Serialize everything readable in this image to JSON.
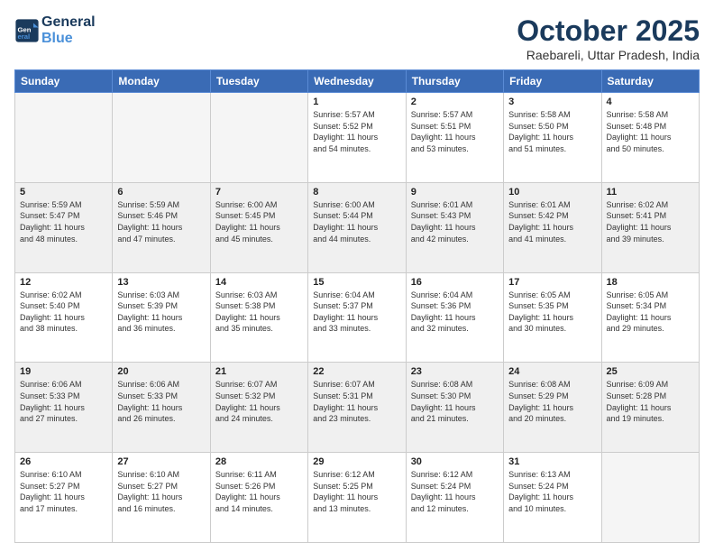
{
  "logo": {
    "line1": "General",
    "line2": "Blue"
  },
  "header": {
    "month": "October 2025",
    "location": "Raebareli, Uttar Pradesh, India"
  },
  "weekdays": [
    "Sunday",
    "Monday",
    "Tuesday",
    "Wednesday",
    "Thursday",
    "Friday",
    "Saturday"
  ],
  "weeks": [
    [
      {
        "day": "",
        "info": ""
      },
      {
        "day": "",
        "info": ""
      },
      {
        "day": "",
        "info": ""
      },
      {
        "day": "1",
        "info": "Sunrise: 5:57 AM\nSunset: 5:52 PM\nDaylight: 11 hours\nand 54 minutes."
      },
      {
        "day": "2",
        "info": "Sunrise: 5:57 AM\nSunset: 5:51 PM\nDaylight: 11 hours\nand 53 minutes."
      },
      {
        "day": "3",
        "info": "Sunrise: 5:58 AM\nSunset: 5:50 PM\nDaylight: 11 hours\nand 51 minutes."
      },
      {
        "day": "4",
        "info": "Sunrise: 5:58 AM\nSunset: 5:48 PM\nDaylight: 11 hours\nand 50 minutes."
      }
    ],
    [
      {
        "day": "5",
        "info": "Sunrise: 5:59 AM\nSunset: 5:47 PM\nDaylight: 11 hours\nand 48 minutes."
      },
      {
        "day": "6",
        "info": "Sunrise: 5:59 AM\nSunset: 5:46 PM\nDaylight: 11 hours\nand 47 minutes."
      },
      {
        "day": "7",
        "info": "Sunrise: 6:00 AM\nSunset: 5:45 PM\nDaylight: 11 hours\nand 45 minutes."
      },
      {
        "day": "8",
        "info": "Sunrise: 6:00 AM\nSunset: 5:44 PM\nDaylight: 11 hours\nand 44 minutes."
      },
      {
        "day": "9",
        "info": "Sunrise: 6:01 AM\nSunset: 5:43 PM\nDaylight: 11 hours\nand 42 minutes."
      },
      {
        "day": "10",
        "info": "Sunrise: 6:01 AM\nSunset: 5:42 PM\nDaylight: 11 hours\nand 41 minutes."
      },
      {
        "day": "11",
        "info": "Sunrise: 6:02 AM\nSunset: 5:41 PM\nDaylight: 11 hours\nand 39 minutes."
      }
    ],
    [
      {
        "day": "12",
        "info": "Sunrise: 6:02 AM\nSunset: 5:40 PM\nDaylight: 11 hours\nand 38 minutes."
      },
      {
        "day": "13",
        "info": "Sunrise: 6:03 AM\nSunset: 5:39 PM\nDaylight: 11 hours\nand 36 minutes."
      },
      {
        "day": "14",
        "info": "Sunrise: 6:03 AM\nSunset: 5:38 PM\nDaylight: 11 hours\nand 35 minutes."
      },
      {
        "day": "15",
        "info": "Sunrise: 6:04 AM\nSunset: 5:37 PM\nDaylight: 11 hours\nand 33 minutes."
      },
      {
        "day": "16",
        "info": "Sunrise: 6:04 AM\nSunset: 5:36 PM\nDaylight: 11 hours\nand 32 minutes."
      },
      {
        "day": "17",
        "info": "Sunrise: 6:05 AM\nSunset: 5:35 PM\nDaylight: 11 hours\nand 30 minutes."
      },
      {
        "day": "18",
        "info": "Sunrise: 6:05 AM\nSunset: 5:34 PM\nDaylight: 11 hours\nand 29 minutes."
      }
    ],
    [
      {
        "day": "19",
        "info": "Sunrise: 6:06 AM\nSunset: 5:33 PM\nDaylight: 11 hours\nand 27 minutes."
      },
      {
        "day": "20",
        "info": "Sunrise: 6:06 AM\nSunset: 5:33 PM\nDaylight: 11 hours\nand 26 minutes."
      },
      {
        "day": "21",
        "info": "Sunrise: 6:07 AM\nSunset: 5:32 PM\nDaylight: 11 hours\nand 24 minutes."
      },
      {
        "day": "22",
        "info": "Sunrise: 6:07 AM\nSunset: 5:31 PM\nDaylight: 11 hours\nand 23 minutes."
      },
      {
        "day": "23",
        "info": "Sunrise: 6:08 AM\nSunset: 5:30 PM\nDaylight: 11 hours\nand 21 minutes."
      },
      {
        "day": "24",
        "info": "Sunrise: 6:08 AM\nSunset: 5:29 PM\nDaylight: 11 hours\nand 20 minutes."
      },
      {
        "day": "25",
        "info": "Sunrise: 6:09 AM\nSunset: 5:28 PM\nDaylight: 11 hours\nand 19 minutes."
      }
    ],
    [
      {
        "day": "26",
        "info": "Sunrise: 6:10 AM\nSunset: 5:27 PM\nDaylight: 11 hours\nand 17 minutes."
      },
      {
        "day": "27",
        "info": "Sunrise: 6:10 AM\nSunset: 5:27 PM\nDaylight: 11 hours\nand 16 minutes."
      },
      {
        "day": "28",
        "info": "Sunrise: 6:11 AM\nSunset: 5:26 PM\nDaylight: 11 hours\nand 14 minutes."
      },
      {
        "day": "29",
        "info": "Sunrise: 6:12 AM\nSunset: 5:25 PM\nDaylight: 11 hours\nand 13 minutes."
      },
      {
        "day": "30",
        "info": "Sunrise: 6:12 AM\nSunset: 5:24 PM\nDaylight: 11 hours\nand 12 minutes."
      },
      {
        "day": "31",
        "info": "Sunrise: 6:13 AM\nSunset: 5:24 PM\nDaylight: 11 hours\nand 10 minutes."
      },
      {
        "day": "",
        "info": ""
      }
    ]
  ]
}
